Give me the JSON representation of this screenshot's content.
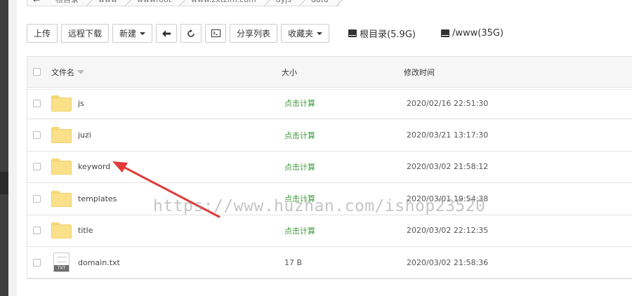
{
  "breadcrumb": {
    "back_label": "←",
    "items": [
      "根目录",
      "www",
      "wwwroot",
      "www.zxtzim.com",
      "dyjs",
      "data"
    ]
  },
  "toolbar": {
    "upload": "上传",
    "remote_download": "远程下载",
    "new": "新建",
    "share_list": "分享列表",
    "favorites": "收藏夹",
    "disk_root": "根目录(5.9G)",
    "disk_www": "/www(35G)"
  },
  "table": {
    "headers": {
      "name": "文件名",
      "size": "大小",
      "modified": "修改时间"
    },
    "rows": [
      {
        "type": "folder",
        "name": "js",
        "size": "点击计算",
        "modified": "2020/02/16 22:51:30"
      },
      {
        "type": "folder",
        "name": "juzi",
        "size": "点击计算",
        "modified": "2020/03/21 13:17:30"
      },
      {
        "type": "folder",
        "name": "keyword",
        "size": "点击计算",
        "modified": "2020/03/02 21:58:12"
      },
      {
        "type": "folder",
        "name": "templates",
        "size": "点击计算",
        "modified": "2020/03/01 19:54:38"
      },
      {
        "type": "folder",
        "name": "title",
        "size": "点击计算",
        "modified": "2020/03/02 22:12:35"
      },
      {
        "type": "file",
        "name": "domain.txt",
        "size": "17 B",
        "modified": "2020/03/02 21:58:36",
        "icon_label": "TXT"
      }
    ]
  },
  "watermark": "https://www.huzhan.com/ishop23520",
  "colors": {
    "calc_green": "#3c9a3c",
    "annotation_red": "#e03a3a",
    "folder_yellow": "#fbe08a"
  }
}
